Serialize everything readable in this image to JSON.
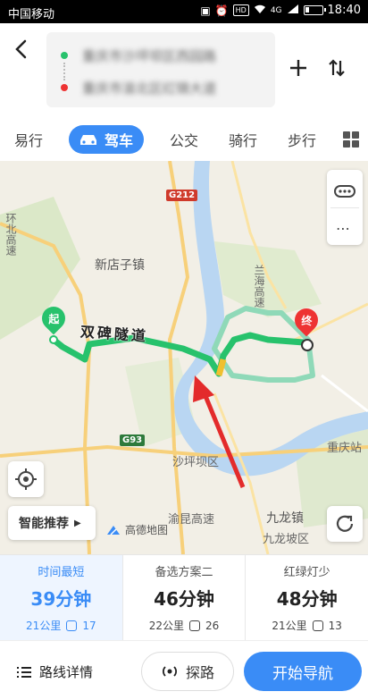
{
  "status_bar": {
    "carrier": "中国移动",
    "time": "18:40",
    "hd": "HD",
    "net": "4G"
  },
  "header": {
    "start_location": "重庆市沙坪坝区西园路",
    "end_location": "重庆市渝北区红锦大道",
    "back_icon": "back-arrow-icon",
    "add_icon": "plus-icon",
    "swap_icon": "swap-icon"
  },
  "tabs": [
    {
      "label": "易行"
    },
    {
      "label": "驾车",
      "active": true
    },
    {
      "label": "公交"
    },
    {
      "label": "骑行"
    },
    {
      "label": "步行"
    }
  ],
  "map": {
    "labels": {
      "huanbei": "环北高速",
      "xindianzi": "新店子镇",
      "lanhai": "兰海高速",
      "shapingba": "沙坪坝区",
      "chongqing_station": "重庆站",
      "yukun": "渝昆高速",
      "jiulong": "九龙镇",
      "jiulongpo": "九龙坡区"
    },
    "shields": {
      "g212": "G212",
      "g93": "G93"
    },
    "tunnel": "双碑隧道",
    "start_pin": "起",
    "end_pin": "终",
    "smart_recommend": "智能推荐",
    "logo": "高德地图",
    "colors": {
      "route_green": "#27c26c",
      "route_alt": "#8fd9b8",
      "water": "#b9d6f2",
      "arrow": "#e32b2b"
    }
  },
  "routes": [
    {
      "tag": "时间最短",
      "time": "39分钟",
      "distance": "21公里",
      "lights": "17"
    },
    {
      "tag": "备选方案二",
      "time": "46分钟",
      "distance": "22公里",
      "lights": "26"
    },
    {
      "tag": "红绿灯少",
      "time": "48分钟",
      "distance": "21公里",
      "lights": "13"
    }
  ],
  "bottom": {
    "details": "路线详情",
    "explore": "探路",
    "start_nav": "开始导航"
  }
}
